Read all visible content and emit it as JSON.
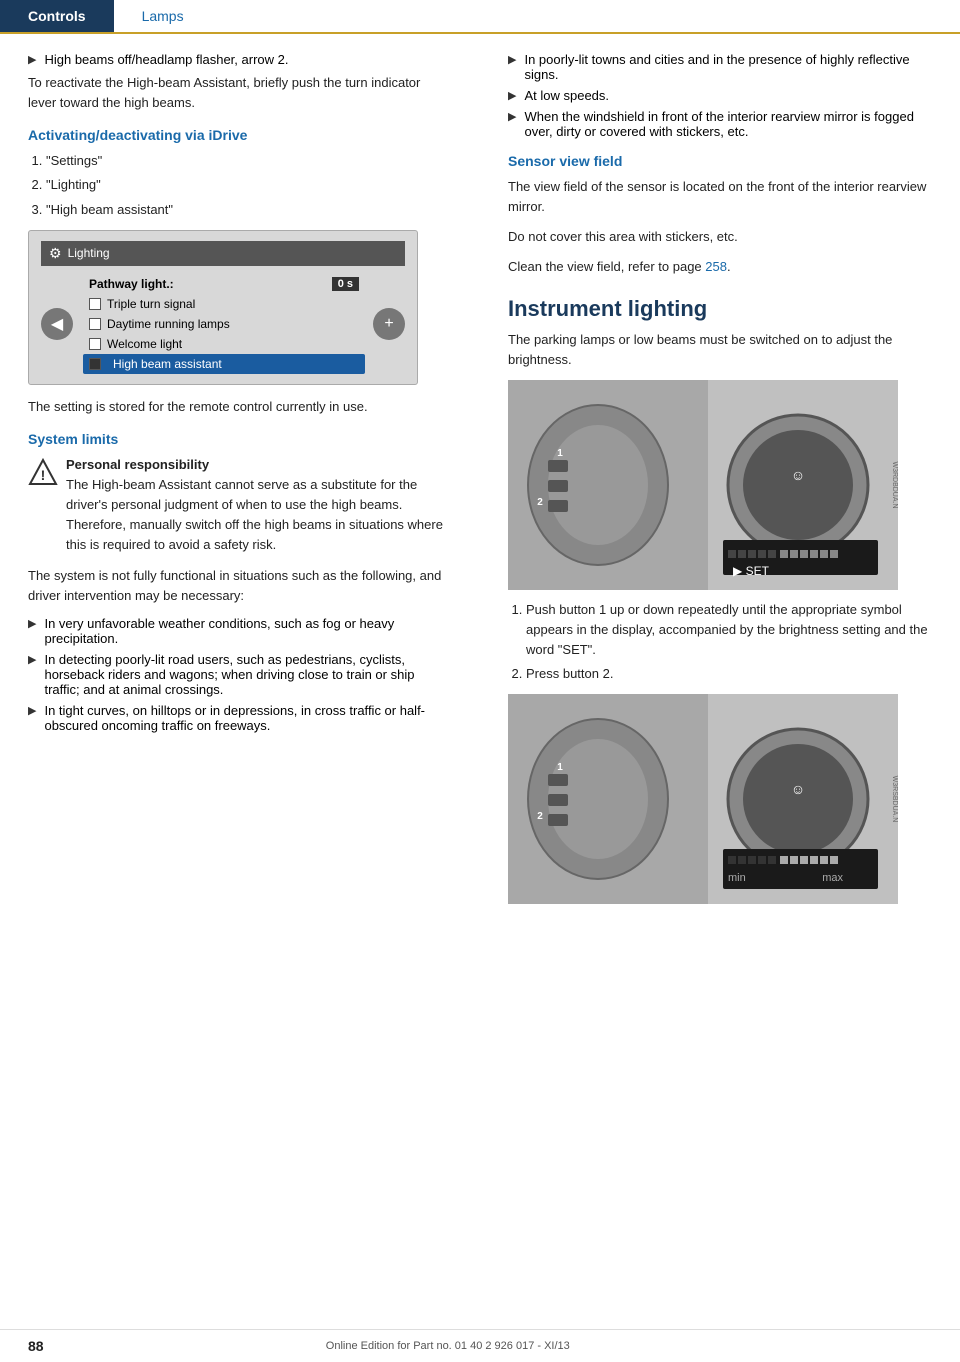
{
  "header": {
    "tab_controls": "Controls",
    "tab_lamps": "Lamps"
  },
  "left_col": {
    "bullet1": "High beams off/headlamp flasher, arrow 2.",
    "reactivate_text": "To reactivate the High-beam Assistant, briefly push the turn indicator lever toward the high beams.",
    "idrive_section": {
      "heading": "Activating/deactivating via iDrive",
      "steps": [
        "\"Settings\"",
        "\"Lighting\"",
        "\"High beam assistant\""
      ],
      "screen": {
        "title": "Lighting",
        "pathway_label": "Pathway light.:",
        "pathway_value": "0 s",
        "checkbox1": "Triple turn signal",
        "checkbox2": "Daytime running lamps",
        "checkbox3": "Welcome light",
        "highlighted": "High beam assistant"
      }
    },
    "setting_stored_text": "The setting is stored for the remote control currently in use.",
    "system_limits": {
      "heading": "System limits",
      "warning_title": "Personal responsibility",
      "warning_text": "The High-beam Assistant cannot serve as a substitute for the driver's personal judgment of when to use the high beams. Therefore, manually switch off the high beams in situations where this is required to avoid a safety risk.",
      "not_functional_text": "The system is not fully functional in situations such as the following, and driver intervention may be necessary:",
      "bullets": [
        "In very unfavorable weather conditions, such as fog or heavy precipitation.",
        "In detecting poorly-lit road users, such as pedestrians, cyclists, horseback riders and wagons; when driving close to train or ship traffic; and at animal crossings.",
        "In tight curves, on hilltops or in depressions, in cross traffic or half-obscured oncoming traffic on freeways."
      ]
    }
  },
  "right_col": {
    "bullets": [
      "In poorly-lit towns and cities and in the presence of highly reflective signs.",
      "At low speeds.",
      "When the windshield in front of the interior rearview mirror is fogged over, dirty or covered with stickers, etc."
    ],
    "sensor_view_field": {
      "heading": "Sensor view field",
      "text1": "The view field of the sensor is located on the front of the interior rearview mirror.",
      "text2": "Do not cover this area with stickers, etc.",
      "text3": "Clean the view field, refer to page",
      "page_ref": "258",
      "text3_end": "."
    },
    "instrument_lighting": {
      "heading": "Instrument lighting",
      "intro": "The parking lamps or low beams must be switched on to adjust the brightness.",
      "steps": [
        "Push button 1 up or down repeatedly until the appropriate symbol appears in the display, accompanied by the brightness setting and the word \"SET\".",
        "Press button 2."
      ],
      "diagram1_label": "W3RDBDUA.N",
      "diagram2_label": "W3RSBDUA.N"
    }
  },
  "footer": {
    "page_number": "88",
    "center_text": "Online Edition for Part no. 01 40 2 926 017 - XI/13"
  }
}
